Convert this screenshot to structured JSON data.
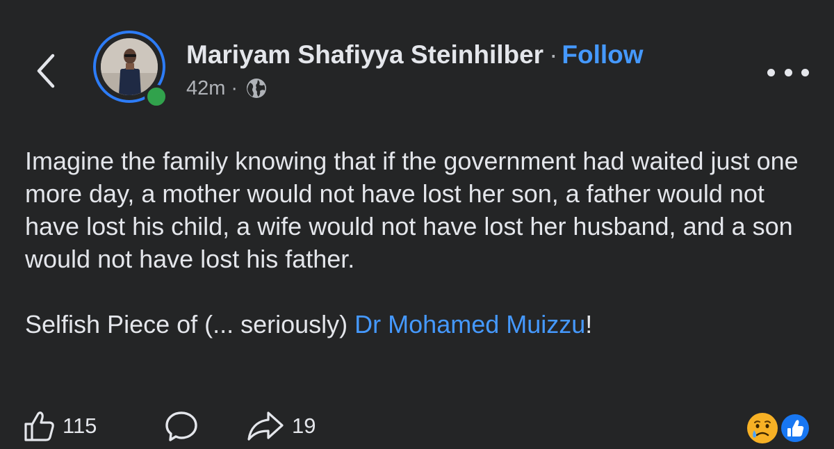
{
  "header": {
    "author_name": "Mariyam Shafiyya Steinhilber",
    "separator": "·",
    "follow_label": "Follow",
    "time_ago": "42m",
    "meta_separator": "·"
  },
  "post": {
    "text": "Imagine the family knowing that if the government had waited just one more day, a mother would not have lost her son, a father would not have lost his child, a wife would not have lost her husband, and a son would not have lost his father.",
    "second_line_prefix": "Selfish Piece of (... seriously) ",
    "mention": "Dr Mohamed Muizzu",
    "second_line_suffix": "!"
  },
  "actions": {
    "like_count": "115",
    "share_count": "19"
  },
  "icons": {
    "back": "chevron-left-icon",
    "privacy": "globe-icon",
    "more": "more-horizontal-icon",
    "like": "thumbs-up-icon",
    "comment": "comment-bubble-icon",
    "share": "share-arrow-icon",
    "reaction_sad": "sad-reaction-icon",
    "reaction_like": "like-reaction-icon"
  },
  "colors": {
    "background": "#242526",
    "text_primary": "#e4e6eb",
    "text_secondary": "#b0b3b8",
    "link_blue": "#4599ff",
    "ring_blue": "#2d7cf6",
    "online_green": "#31a24c"
  }
}
